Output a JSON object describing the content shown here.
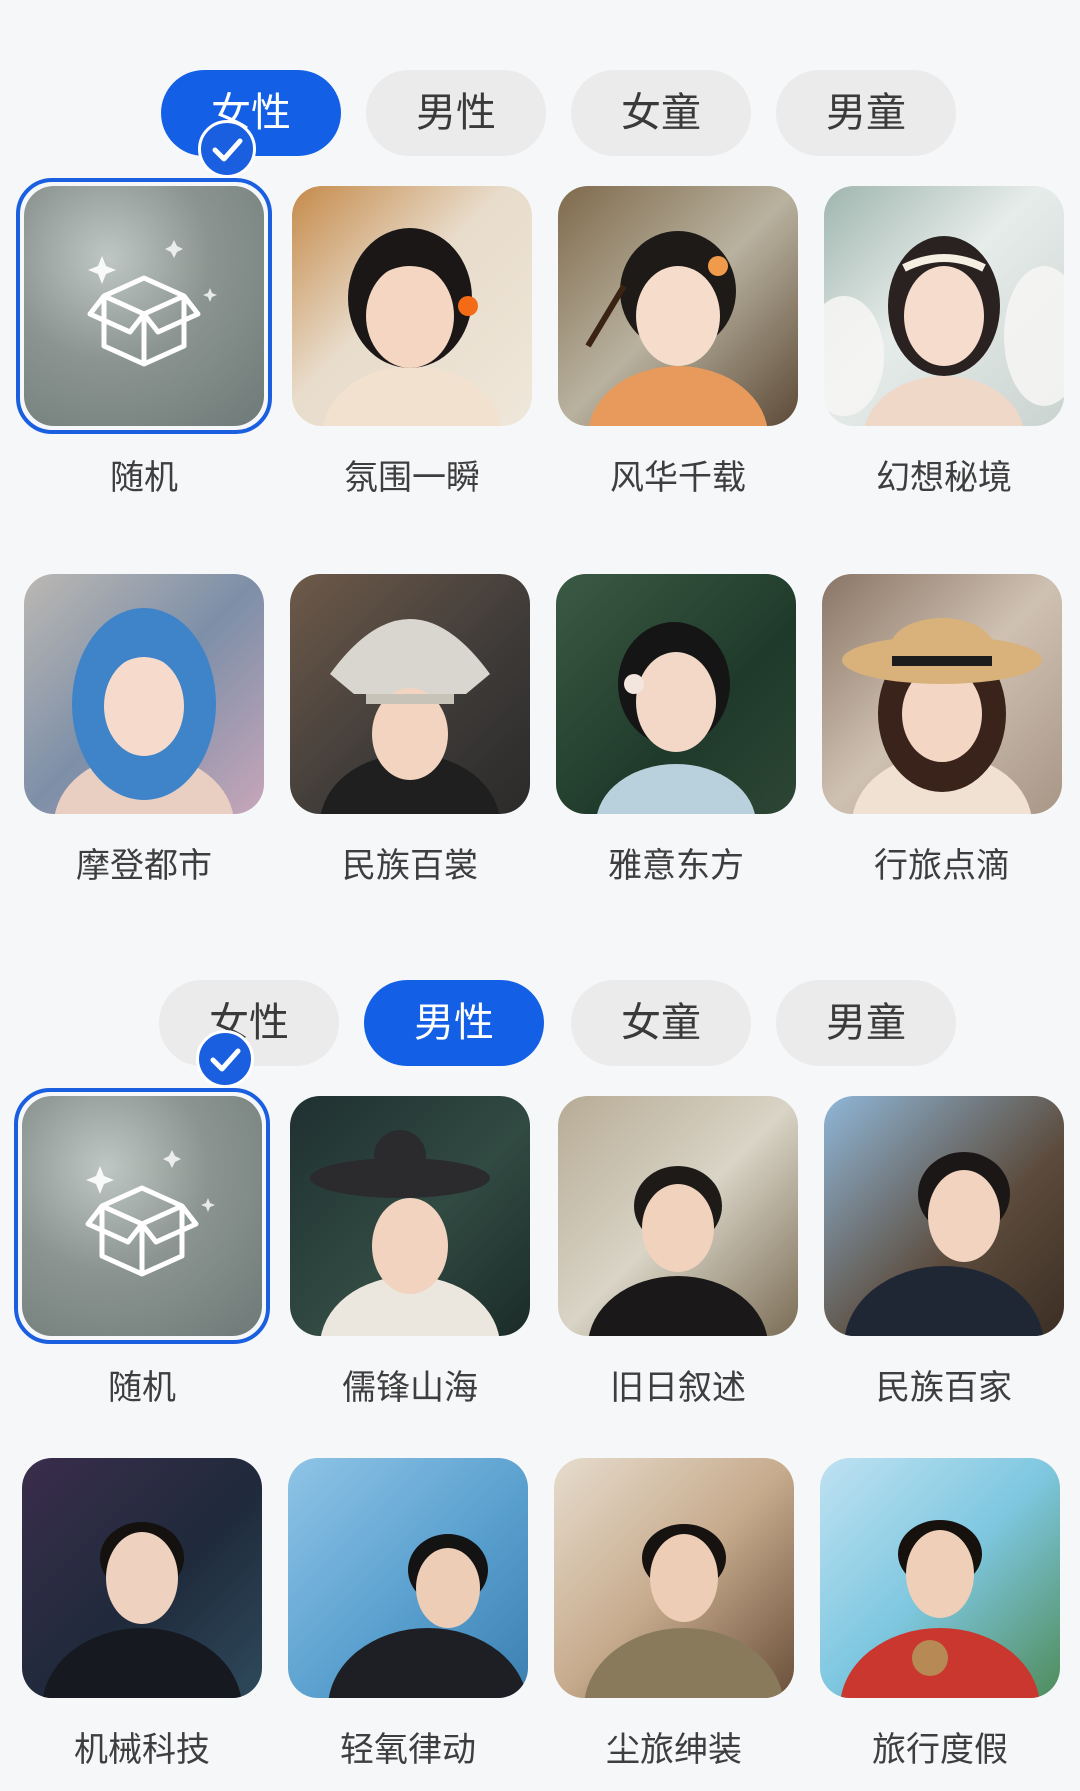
{
  "colors": {
    "accent": "#1360e6",
    "tab_inactive": "#ebebeb",
    "background": "#f6f7f9"
  },
  "female_section": {
    "tabs": [
      {
        "label": "女性",
        "active": true
      },
      {
        "label": "男性",
        "active": false
      },
      {
        "label": "女童",
        "active": false
      },
      {
        "label": "男童",
        "active": false
      }
    ],
    "styles": [
      {
        "label": "随机",
        "selected": true,
        "icon": "random-box-icon"
      },
      {
        "label": "氛围一瞬"
      },
      {
        "label": "风华千载"
      },
      {
        "label": "幻想秘境"
      },
      {
        "label": "摩登都市"
      },
      {
        "label": "民族百裳"
      },
      {
        "label": "雅意东方"
      },
      {
        "label": "行旅点滴"
      }
    ]
  },
  "male_section": {
    "tabs": [
      {
        "label": "女性",
        "active": false
      },
      {
        "label": "男性",
        "active": true
      },
      {
        "label": "女童",
        "active": false
      },
      {
        "label": "男童",
        "active": false
      }
    ],
    "styles": [
      {
        "label": "随机",
        "selected": true,
        "icon": "random-box-icon"
      },
      {
        "label": "儒锋山海"
      },
      {
        "label": "旧日叙述"
      },
      {
        "label": "民族百家"
      },
      {
        "label": "机械科技"
      },
      {
        "label": "轻氧律动"
      },
      {
        "label": "尘旅绅装"
      },
      {
        "label": "旅行度假"
      }
    ]
  }
}
